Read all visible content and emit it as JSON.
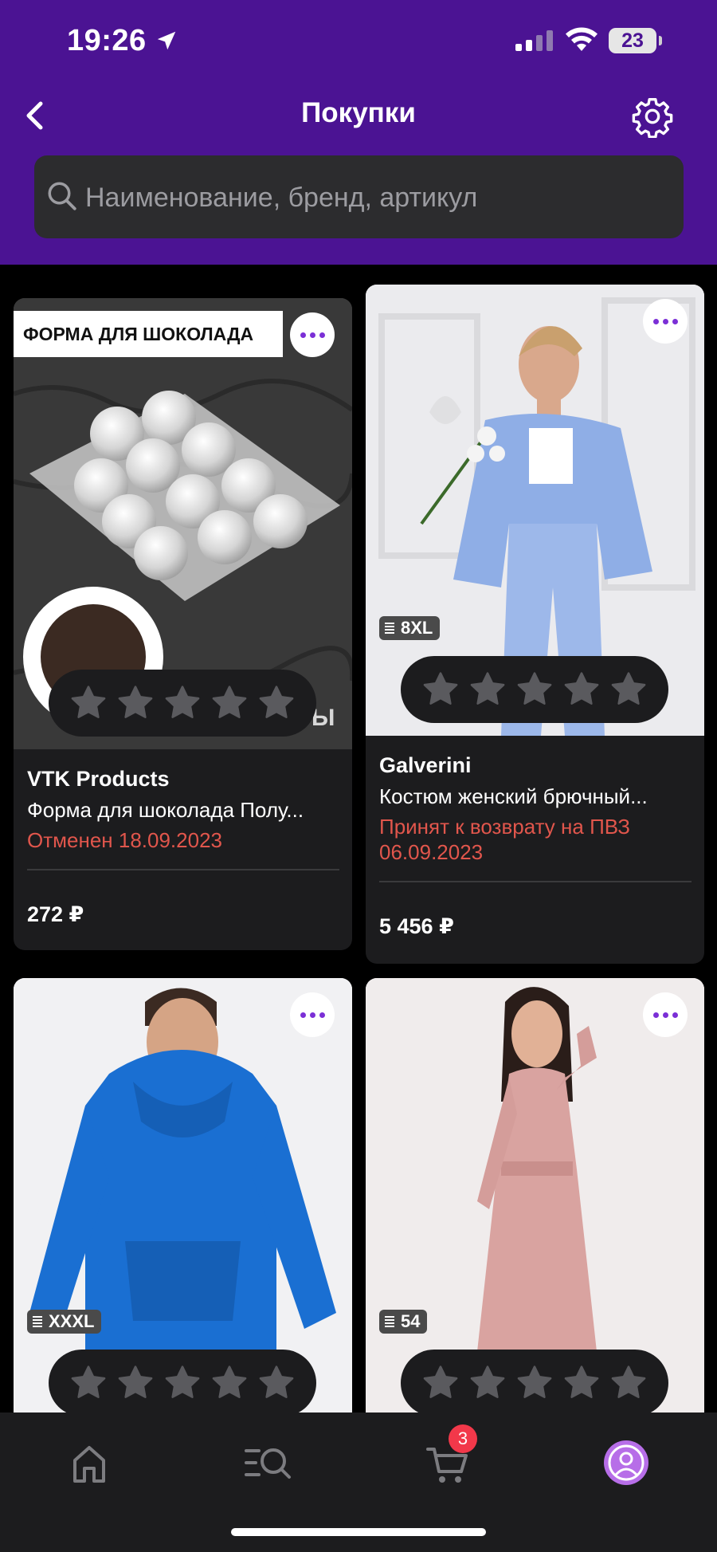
{
  "status_bar": {
    "time": "19:26",
    "battery": "23"
  },
  "header": {
    "title": "Покупки"
  },
  "search": {
    "placeholder": "Наименование, бренд, артикул"
  },
  "products": [
    {
      "banner": "ФОРМА ДЛЯ ШОКОЛАДА",
      "image_overlay_text": "Ы",
      "brand": "VTK Products",
      "name": "Форма для шоколада Полу...",
      "status": "Отменен 18.09.2023",
      "price": "272 ₽",
      "rating": 0
    },
    {
      "size": "8XL",
      "brand": "Galverini",
      "name": "Костюм женский брючный...",
      "status": "Принят к возврату на ПВЗ 06.09.2023",
      "price": "5 456 ₽",
      "rating": 0
    },
    {
      "size": "XXXL",
      "rating": 0
    },
    {
      "size": "54",
      "rating": 0
    }
  ],
  "tab_bar": {
    "items": [
      "home-icon",
      "catalog-search-icon",
      "cart-icon",
      "profile-icon"
    ],
    "cart_count": "3"
  },
  "colors": {
    "header_bg": "#4b1393",
    "accent_purple": "#7b2fd6",
    "status_red": "#e1564c",
    "card_bg": "#1c1c1e",
    "badge_red": "#f2384a"
  }
}
